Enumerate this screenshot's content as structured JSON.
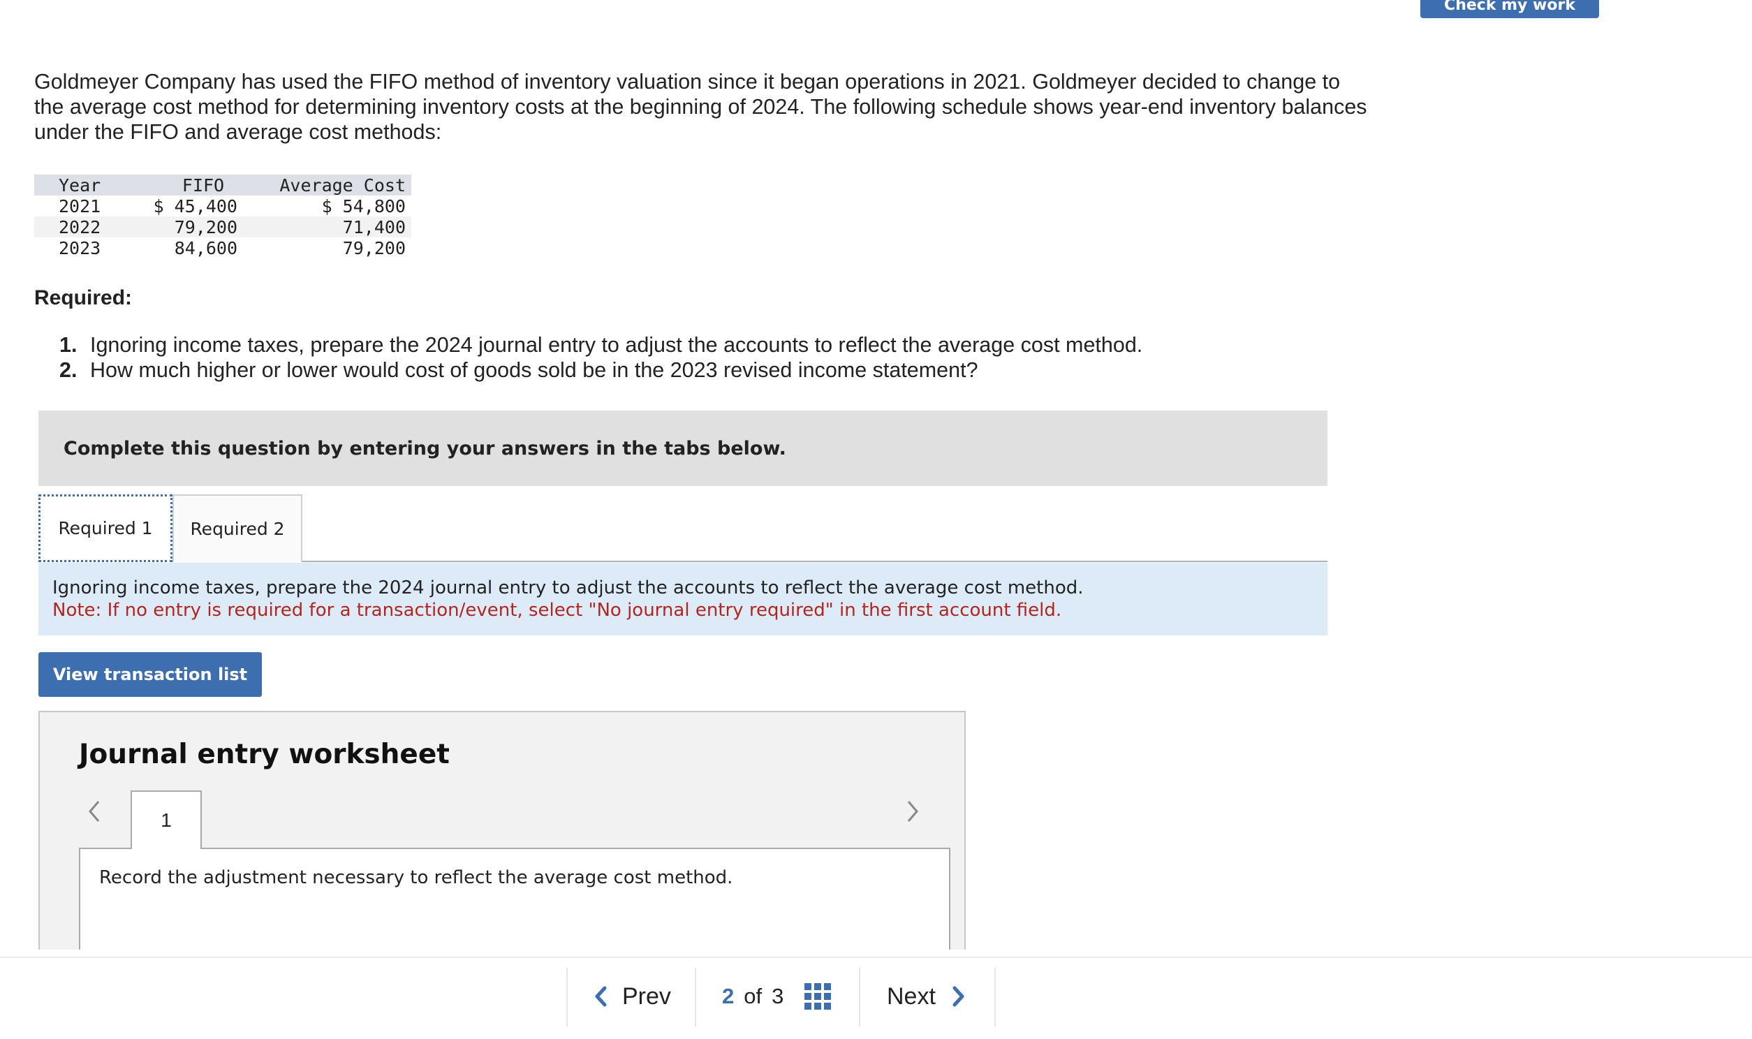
{
  "top_button": {
    "label": "Check my work"
  },
  "problem": {
    "intro": "Goldmeyer Company has used the FIFO method of inventory valuation since it began operations in 2021. Goldmeyer decided to change to the average cost method for determining inventory costs at the beginning of 2024. The following schedule shows year-end inventory balances under the FIFO and average cost methods:",
    "schedule": {
      "headers": [
        "Year",
        "FIFO",
        "Average Cost"
      ],
      "rows": [
        [
          "2021",
          "$ 45,400",
          "$ 54,800"
        ],
        [
          "2022",
          "79,200",
          "71,400"
        ],
        [
          "2023",
          "84,600",
          "79,200"
        ]
      ]
    },
    "required_title": "Required:",
    "required_items": [
      {
        "num": "1.",
        "text": "Ignoring income taxes, prepare the 2024 journal entry to adjust the accounts to reflect the average cost method."
      },
      {
        "num": "2.",
        "text": "How much higher or lower would cost of goods sold be in the 2023 revised income statement?"
      }
    ]
  },
  "banner": {
    "text": "Complete this question by entering your answers in the tabs below."
  },
  "tabs": [
    {
      "label": "Required 1",
      "active": true
    },
    {
      "label": "Required 2",
      "active": false
    }
  ],
  "instruction": {
    "line1": "Ignoring income taxes, prepare the 2024 journal entry to adjust the accounts to reflect the average cost method.",
    "line2": "Note: If no entry is required for a transaction/event, select \"No journal entry required\" in the first account field."
  },
  "view_button": {
    "label": "View transaction list"
  },
  "worksheet": {
    "title": "Journal entry worksheet",
    "current_tab": "1",
    "description": "Record the adjustment necessary to reflect the average cost method."
  },
  "footer": {
    "prev_label": "Prev",
    "current_page": "2",
    "of_label": "of",
    "total_pages": "3",
    "next_label": "Next"
  },
  "colors": {
    "accent": "#3d6fb0",
    "note_red": "#b3261e",
    "instruction_bg": "#ddebf8",
    "banner_bg": "#e0e0e0"
  }
}
